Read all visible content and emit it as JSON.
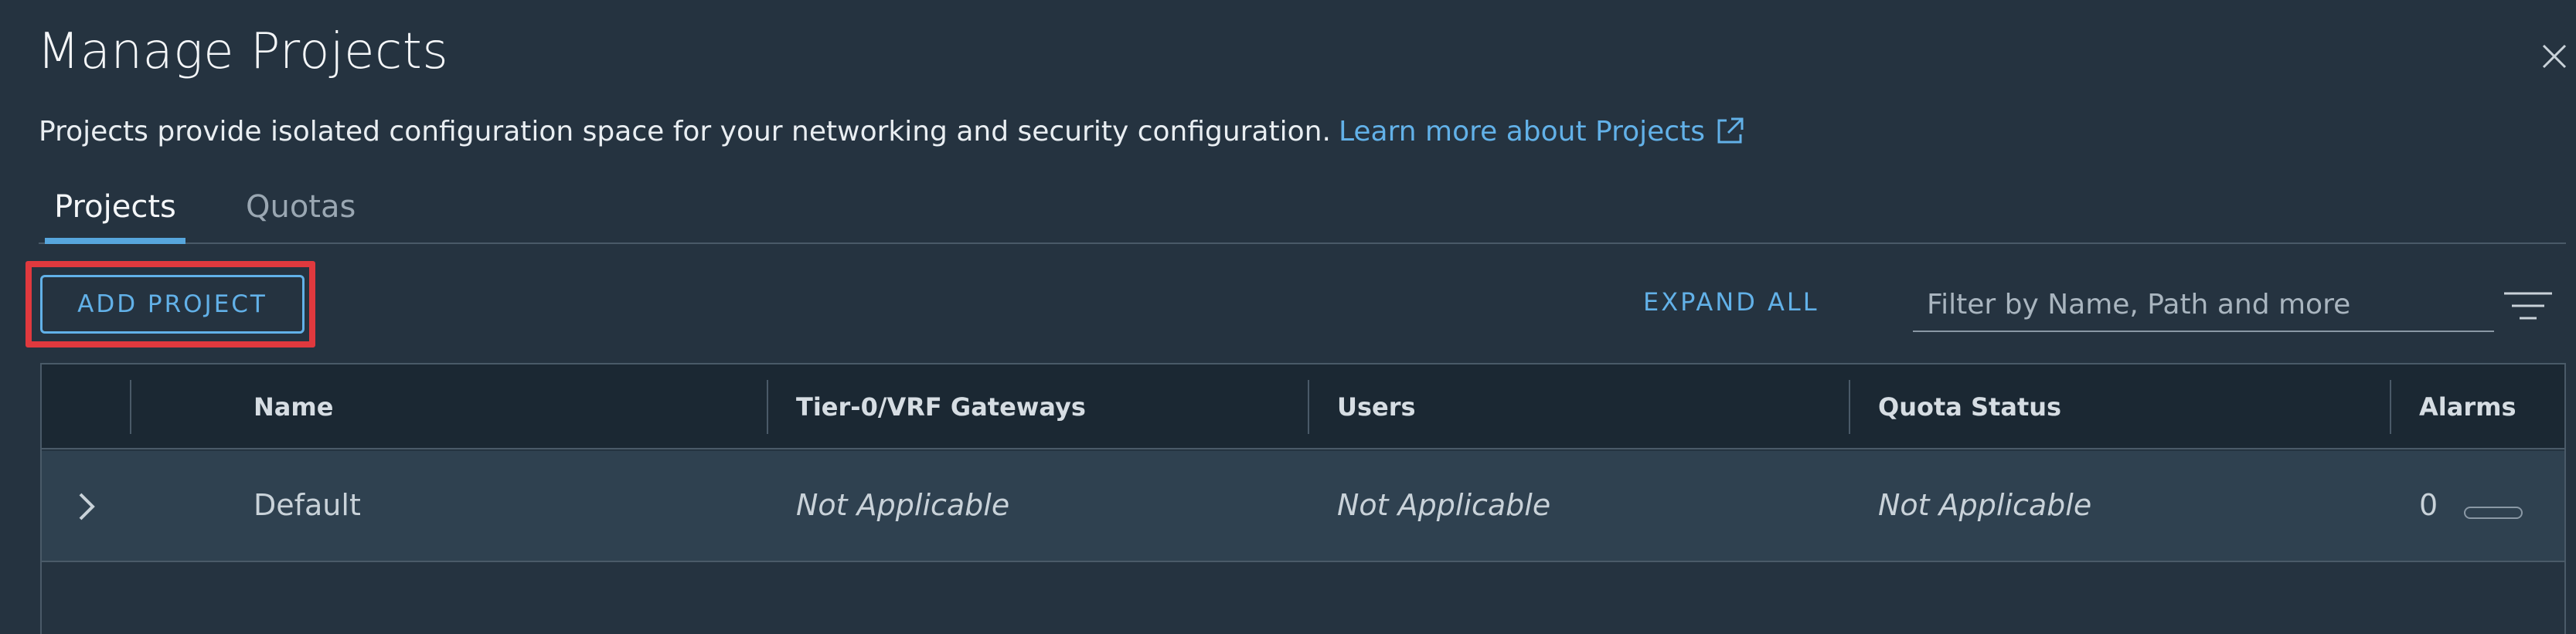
{
  "dialog": {
    "title": "Manage Projects",
    "description": "Projects provide isolated configuration space for your networking and security configuration.",
    "learn_more": "Learn more about Projects"
  },
  "tabs": [
    {
      "label": "Projects",
      "active": true
    },
    {
      "label": "Quotas",
      "active": false
    }
  ],
  "toolbar": {
    "add_label": "ADD PROJECT",
    "expand_label": "EXPAND ALL",
    "filter_placeholder": "Filter by Name, Path and more"
  },
  "grid": {
    "columns": [
      "Name",
      "Tier-0/VRF Gateways",
      "Users",
      "Quota Status",
      "Alarms"
    ],
    "rows": [
      {
        "name": "Default",
        "gateways": "Not Applicable",
        "users": "Not Applicable",
        "quota": "Not Applicable",
        "alarms": "0"
      }
    ]
  },
  "colors": {
    "background": "#253340",
    "accent": "#62b1e8",
    "highlight": "#e0393e"
  },
  "icons": [
    "close-icon",
    "external-link-icon",
    "filter-lines-icon",
    "chevron-right-icon"
  ]
}
